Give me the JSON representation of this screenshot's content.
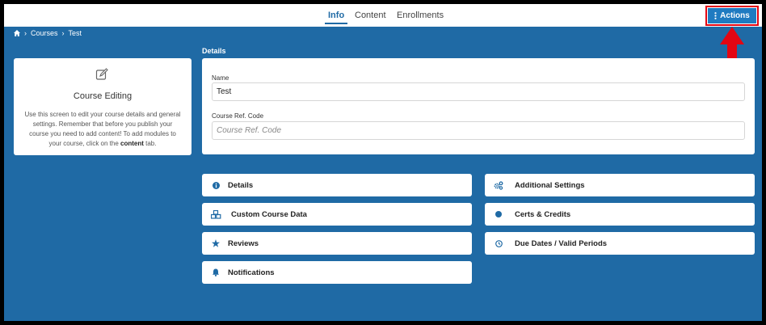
{
  "tabs": [
    {
      "label": "Info",
      "active": true
    },
    {
      "label": "Content",
      "active": false
    },
    {
      "label": "Enrollments",
      "active": false
    }
  ],
  "actions": {
    "label": "Actions",
    "icon": "kebab-icon"
  },
  "breadcrumb": {
    "home_icon": "home-icon",
    "items": [
      "Courses",
      "Test"
    ]
  },
  "info_card": {
    "icon": "edit-icon",
    "title": "Course Editing",
    "text_before_bold": "Use this screen to edit your course details and general settings. Remember that before you publish your course you need to add content! To add modules to your course, click on the ",
    "text_bold": "content",
    "text_after_bold": " tab."
  },
  "details": {
    "section_title": "Details",
    "name_label": "Name",
    "name_value": "Test",
    "ref_label": "Course Ref. Code",
    "ref_placeholder": "Course Ref. Code"
  },
  "tiles": {
    "details": {
      "label": "Details",
      "icon": "info-icon"
    },
    "custom_course_data": {
      "label": "Custom Course Data",
      "icon": "cubes-icon"
    },
    "reviews": {
      "label": "Reviews",
      "icon": "star-icon"
    },
    "notifications": {
      "label": "Notifications",
      "icon": "bell-icon"
    },
    "additional_settings": {
      "label": "Additional Settings",
      "icon": "cogs-icon"
    },
    "certs_credits": {
      "label": "Certs & Credits",
      "icon": "circle-icon"
    },
    "due_dates": {
      "label": "Due Dates / Valid Periods",
      "icon": "clock-icon"
    }
  },
  "colors": {
    "brand": "#1f6aa5",
    "button": "#1f7bc1",
    "highlight": "#e30613"
  }
}
